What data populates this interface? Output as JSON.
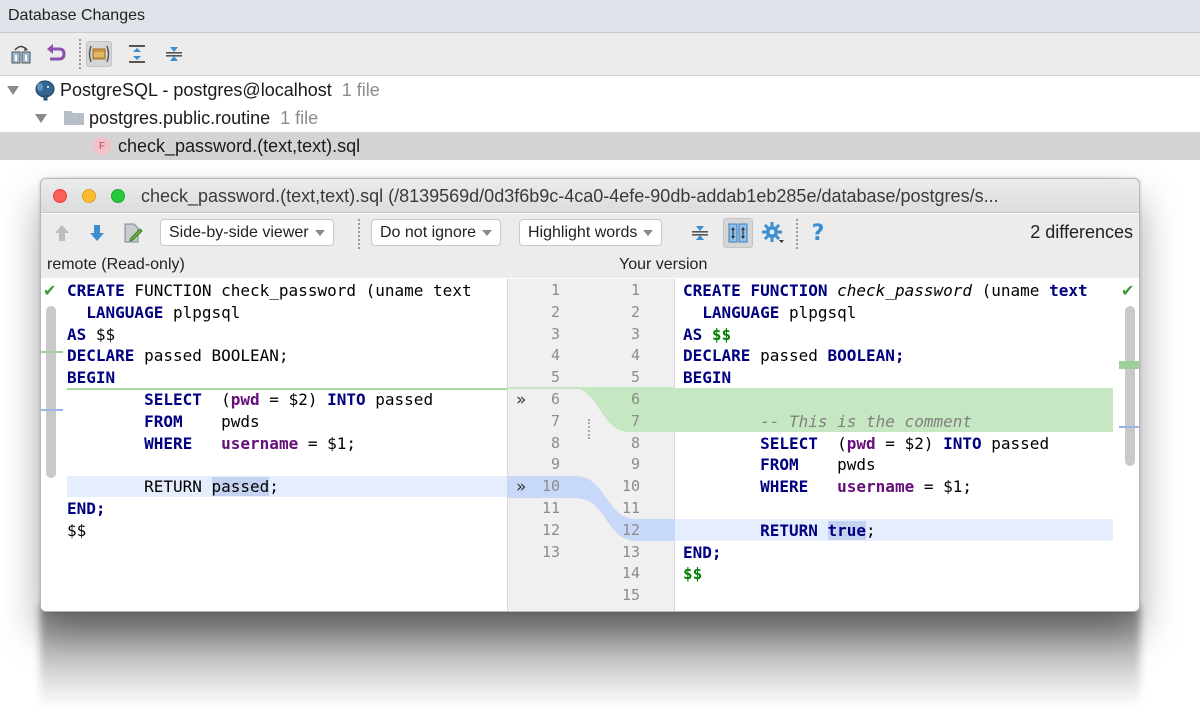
{
  "tool_window": {
    "title": "Database Changes",
    "toolbar": [
      {
        "name": "commit-icon",
        "label": ""
      },
      {
        "name": "revert-icon",
        "label": ""
      },
      {
        "name": "group-by-directory-icon",
        "label": "",
        "active": true
      },
      {
        "name": "expand-all-icon",
        "label": ""
      },
      {
        "name": "collapse-all-icon",
        "label": ""
      }
    ]
  },
  "tree": [
    {
      "label": "PostgreSQL - postgres@localhost",
      "count": "1 file",
      "icon": "postgresql-elephant-icon",
      "level": 0
    },
    {
      "label": "postgres.public.routine",
      "count": "1 file",
      "icon": "folder-icon",
      "level": 1
    },
    {
      "label": "check_password.(text,text).sql",
      "count": "",
      "icon": "function-icon",
      "icon_letter": "F",
      "level": 2,
      "selected": true
    }
  ],
  "dialog": {
    "title": "check_password.(text,text).sql (/8139569d/0d3f6b9c-4ca0-4efe-90db-addab1eb285e/database/postgres/s...",
    "toolbar": {
      "viewer": "Side-by-side viewer",
      "ignore": "Do not ignore",
      "highlight": "Highlight words",
      "differences": "2 differences",
      "help": "?"
    },
    "left_title": "remote (Read-only)",
    "right_title": "Your version",
    "left_line_numbers": [
      "1",
      "2",
      "3",
      "4",
      "5",
      "6",
      "7",
      "8",
      "9",
      "10",
      "11",
      "12",
      "13"
    ],
    "right_line_numbers": [
      "1",
      "2",
      "3",
      "4",
      "5",
      "6",
      "7",
      "8",
      "9",
      "10",
      "11",
      "12",
      "13",
      "14",
      "15"
    ],
    "left_code": [
      [
        {
          "t": "CREATE",
          "c": "kw"
        },
        {
          "t": " FUNCTION check_password (uname text"
        }
      ],
      [
        {
          "t": "  "
        },
        {
          "t": "LANGUAGE",
          "c": "kw"
        },
        {
          "t": " plpgsql"
        }
      ],
      [
        {
          "t": "AS",
          "c": "kw"
        },
        {
          "t": " $$"
        }
      ],
      [
        {
          "t": "DECLARE",
          "c": "kw"
        },
        {
          "t": " passed BOOLEAN;"
        }
      ],
      [
        {
          "t": "BEGIN",
          "c": "kw"
        }
      ],
      [
        {
          "t": "        "
        },
        {
          "t": "SELECT",
          "c": "kw"
        },
        {
          "t": "  ("
        },
        {
          "t": "pwd",
          "c": "id"
        },
        {
          "t": " = $2) "
        },
        {
          "t": "INTO",
          "c": "kw"
        },
        {
          "t": " passed"
        }
      ],
      [
        {
          "t": "        "
        },
        {
          "t": "FROM",
          "c": "kw"
        },
        {
          "t": "    pwds"
        }
      ],
      [
        {
          "t": "        "
        },
        {
          "t": "WHERE",
          "c": "kw"
        },
        {
          "t": "   "
        },
        {
          "t": "username",
          "c": "id"
        },
        {
          "t": " = $1;"
        }
      ],
      [
        {
          "t": ""
        }
      ],
      [
        {
          "t": "        RETURN "
        },
        {
          "t": "passed",
          "c": "word-hl"
        },
        {
          "t": ";"
        }
      ],
      [
        {
          "t": "END;",
          "c": "kw"
        }
      ],
      [
        {
          "t": "$$"
        }
      ],
      [
        {
          "t": ""
        }
      ]
    ],
    "right_code": [
      [
        {
          "t": "CREATE",
          "c": "kw"
        },
        {
          "t": " "
        },
        {
          "t": "FUNCTION",
          "c": "kw"
        },
        {
          "t": " "
        },
        {
          "t": "check_password",
          "c": "it"
        },
        {
          "t": " (uname "
        },
        {
          "t": "text",
          "c": "kw"
        }
      ],
      [
        {
          "t": "  "
        },
        {
          "t": "LANGUAGE",
          "c": "kw"
        },
        {
          "t": " plpgsql"
        }
      ],
      [
        {
          "t": "AS",
          "c": "kw"
        },
        {
          "t": " "
        },
        {
          "t": "$$",
          "c": "str"
        }
      ],
      [
        {
          "t": "DECLARE",
          "c": "kw"
        },
        {
          "t": " passed "
        },
        {
          "t": "BOOLEAN;",
          "c": "kw"
        }
      ],
      [
        {
          "t": "BEGIN",
          "c": "kw"
        }
      ],
      [
        {
          "t": ""
        }
      ],
      [
        {
          "t": "        "
        },
        {
          "t": "-- This is the comment",
          "c": "cmt"
        }
      ],
      [
        {
          "t": "        "
        },
        {
          "t": "SELECT",
          "c": "kw"
        },
        {
          "t": "  ("
        },
        {
          "t": "pwd",
          "c": "id"
        },
        {
          "t": " = $2) "
        },
        {
          "t": "INTO",
          "c": "kw"
        },
        {
          "t": " passed"
        }
      ],
      [
        {
          "t": "        "
        },
        {
          "t": "FROM",
          "c": "kw"
        },
        {
          "t": "    pwds"
        }
      ],
      [
        {
          "t": "        "
        },
        {
          "t": "WHERE",
          "c": "kw"
        },
        {
          "t": "   "
        },
        {
          "t": "username",
          "c": "id"
        },
        {
          "t": " = $1;"
        }
      ],
      [
        {
          "t": ""
        }
      ],
      [
        {
          "t": "        "
        },
        {
          "t": "RETURN",
          "c": "kw"
        },
        {
          "t": " "
        },
        {
          "t": "true",
          "c": "kw word-hl"
        },
        {
          "t": ";"
        }
      ],
      [
        {
          "t": "END;",
          "c": "kw"
        }
      ],
      [
        {
          "t": "$$",
          "c": "str"
        }
      ],
      [
        {
          "t": ""
        }
      ]
    ],
    "changes": [
      {
        "type": "inserted",
        "left_after_line": 5,
        "right_lines": [
          6,
          7
        ],
        "color": "#c5e7c1"
      },
      {
        "type": "modified",
        "left_lines": [
          10
        ],
        "right_lines": [
          12
        ],
        "color": "#c8d8f8"
      }
    ]
  },
  "colors": {
    "inserted": "#c5e7c1",
    "modified": "#e6edfc",
    "keyword": "#000080",
    "identifier": "#660e7a",
    "string": "#008000",
    "comment": "#808080"
  }
}
